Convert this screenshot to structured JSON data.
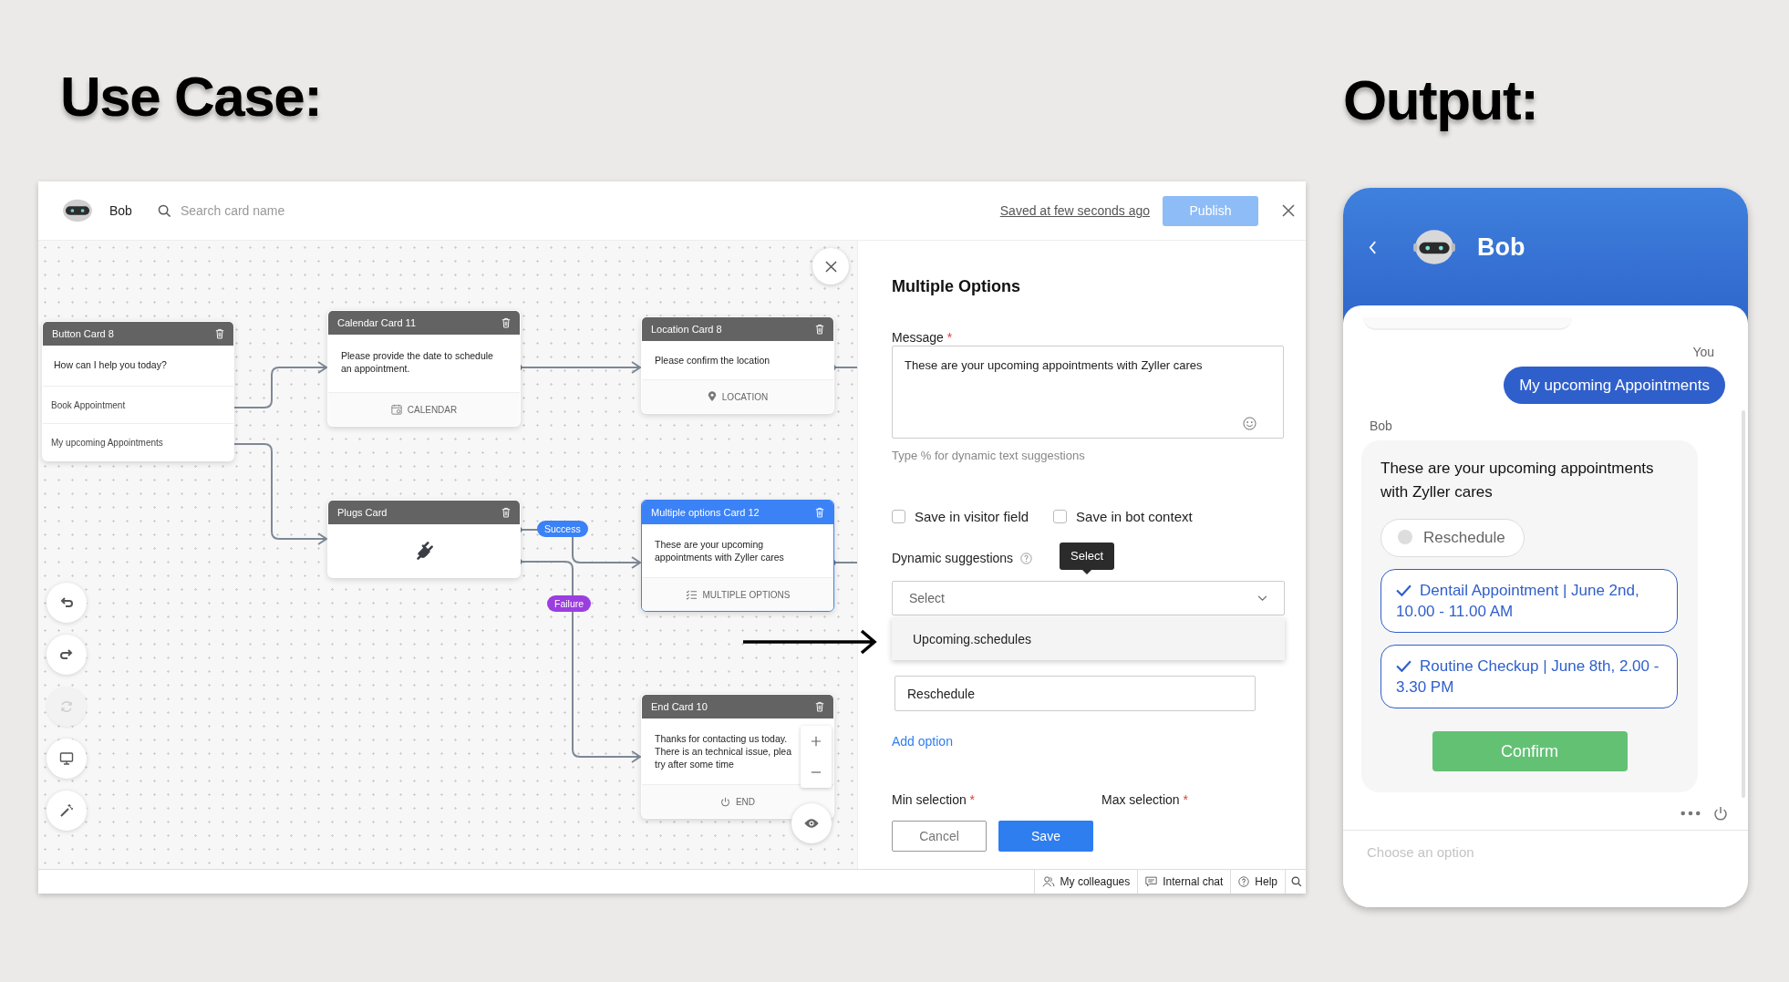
{
  "use_case_heading": "Use Case:",
  "output_heading": "Output:",
  "editor": {
    "header": {
      "bot_name": "Bob",
      "search_placeholder": "Search card name",
      "saved_status": "Saved at few seconds ago",
      "publish": {
        "label": "Publish",
        "disabled": true
      }
    },
    "canvas": {
      "cards": [
        {
          "title": "Button Card 8",
          "kind": "button",
          "selected": false,
          "message_lines": [
            "How can I help you today?"
          ],
          "options": [
            "Book Appointment",
            "My upcoming Appointments"
          ]
        },
        {
          "title": "Calendar Card 11",
          "kind": "calendar",
          "selected": false,
          "message_lines": [
            "Please provide the date to schedule",
            "an appointment."
          ],
          "footer": "CALENDAR"
        },
        {
          "title": "Location Card 8",
          "kind": "location",
          "selected": false,
          "message_lines": [
            "Please confirm the location"
          ],
          "footer": "LOCATION"
        },
        {
          "title": "Plugs Card",
          "kind": "plugs",
          "selected": false
        },
        {
          "title": "Multiple options Card 12",
          "kind": "multiple_options",
          "selected": true,
          "message_lines": [
            "These are your upcoming",
            "appointments with Zyller cares"
          ],
          "footer": "MULTIPLE OPTIONS"
        },
        {
          "title": "End Card 10",
          "kind": "end",
          "selected": false,
          "message_lines": [
            "Thanks for contacting us today.",
            "There is an technical issue, plea",
            "try after some time"
          ],
          "footer": "END"
        }
      ],
      "edge_labels": [
        {
          "text": "Success",
          "color": "#3b82f6"
        },
        {
          "text": "Failure",
          "color": "#9b3ee0"
        }
      ],
      "tools": [
        {
          "kind": "undo",
          "disabled": false
        },
        {
          "kind": "redo",
          "disabled": false
        },
        {
          "kind": "refresh",
          "disabled": true
        },
        {
          "kind": "preview",
          "disabled": false
        },
        {
          "kind": "magic",
          "disabled": false
        }
      ]
    },
    "panel": {
      "title": "Multiple Options",
      "message_label": {
        "text": "Message",
        "required_mark": "*"
      },
      "message_value": "These are your upcoming appointments with Zyller cares",
      "hint": "Type % for dynamic text suggestions",
      "checkboxes": [
        {
          "label": "Save in visitor field",
          "checked": false
        },
        {
          "label": "Save in bot context",
          "checked": false
        }
      ],
      "dynamic_suggestions": {
        "label": "Dynamic suggestions",
        "tooltip": "Select",
        "placeholder": "Select",
        "menu_items": [
          "Upcoming.schedules"
        ]
      },
      "item_name_value": "Reschedule",
      "add_option": "Add option",
      "min_selection": {
        "text": "Min selection",
        "required_mark": "*"
      },
      "max_selection": {
        "text": "Max selection",
        "required_mark": "*"
      },
      "cancel": "Cancel",
      "save": "Save"
    },
    "status_bar": [
      {
        "kind": "colleagues",
        "label": "My colleagues"
      },
      {
        "kind": "chat",
        "label": "Internal chat"
      },
      {
        "kind": "help",
        "label": "Help"
      }
    ]
  },
  "chat": {
    "bot_name": "Bob",
    "you_label": "You",
    "user_message": "My upcoming Appointments",
    "bot_label": "Bob",
    "bot_message": "These are your upcoming appointments with Zyller cares",
    "options": [
      {
        "label": "Reschedule",
        "selected": false
      },
      {
        "label": "Dentail Appointment | June 2nd, 10.00 - 11.00 AM",
        "selected": true
      },
      {
        "label": "Routine Checkup | June 8th, 2.00 - 3.30 PM",
        "selected": true
      }
    ],
    "confirm": "Confirm",
    "input_placeholder": "Choose an option"
  }
}
